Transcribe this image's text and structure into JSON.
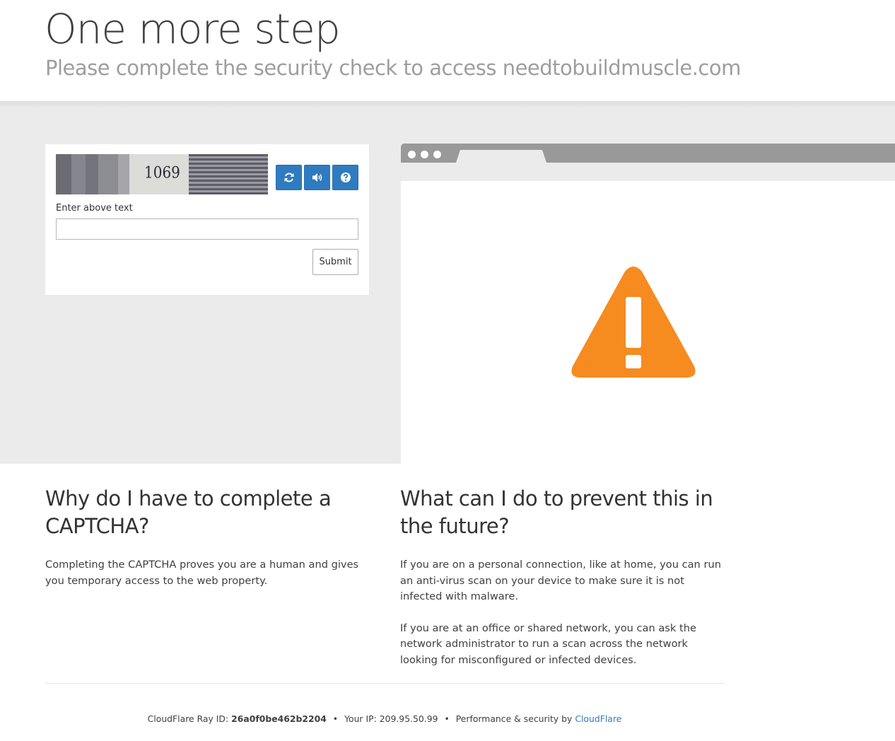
{
  "header": {
    "title": "One more step",
    "subtitle": "Please complete the security check to access needtobuildmuscle.com"
  },
  "captcha": {
    "image_text": "1069",
    "reload_icon": "refresh-icon",
    "audio_icon": "speaker-icon",
    "help_icon": "question-icon",
    "label": "Enter above text",
    "input_value": "",
    "submit_label": "Submit",
    "button_color": "#2f7bbf"
  },
  "illustration": {
    "icon": "warning-triangle-icon",
    "color": "#f68b1f"
  },
  "why": {
    "heading": "Why do I have to complete a CAPTCHA?",
    "body": "Completing the CAPTCHA proves you are a human and gives you temporary access to the web property."
  },
  "prevent": {
    "heading": "What can I do to prevent this in the future?",
    "paragraph1": "If you are on a personal connection, like at home, you can run an anti-virus scan on your device to make sure it is not infected with malware.",
    "paragraph2": "If you are at an office or shared network, you can ask the network administrator to run a scan across the network looking for misconfigured or infected devices."
  },
  "footer": {
    "ray_label": "CloudFlare Ray ID:",
    "ray_id": "26a0f0be462b2204",
    "separator": "•",
    "ip_label": "Your IP:",
    "ip": "209.95.50.99",
    "perf_label": "Performance & security by",
    "brand_link": "CloudFlare",
    "link_color": "#2f7bbf"
  }
}
